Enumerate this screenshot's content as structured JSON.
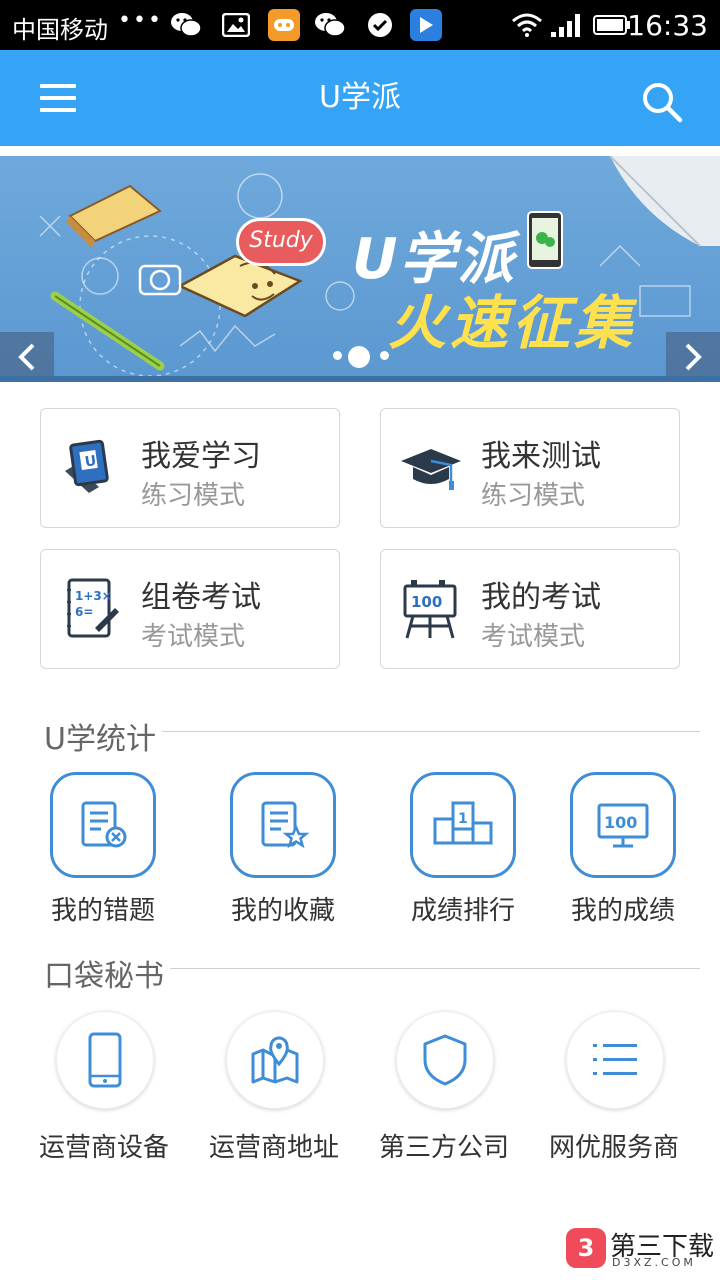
{
  "status_bar": {
    "carrier": "中国移动",
    "dots": "•••",
    "time": "16:33"
  },
  "app_bar": {
    "title": "U学派"
  },
  "banner": {
    "line1": "U学派",
    "line2": "火速征集",
    "study_tag": "Study"
  },
  "tiles": [
    {
      "title": "我爱学习",
      "subtitle": "练习模式",
      "icon": "book-icon"
    },
    {
      "title": "我来测试",
      "subtitle": "练习模式",
      "icon": "graduation-cap-icon"
    },
    {
      "title": "组卷考试",
      "subtitle": "考试模式",
      "icon": "math-notebook-icon"
    },
    {
      "title": "我的考试",
      "subtitle": "考试模式",
      "icon": "score-easel-icon"
    }
  ],
  "stats": {
    "title": "U学统计",
    "items": [
      {
        "label": "我的错题",
        "icon": "wrong-answers-icon"
      },
      {
        "label": "我的收藏",
        "icon": "favorites-icon"
      },
      {
        "label": "成绩排行",
        "icon": "ranking-icon"
      },
      {
        "label": "我的成绩",
        "icon": "score-monitor-icon"
      }
    ]
  },
  "pocket": {
    "title": "口袋秘书",
    "items": [
      {
        "label": "运营商设备",
        "icon": "phone-icon"
      },
      {
        "label": "运营商地址",
        "icon": "map-icon"
      },
      {
        "label": "第三方公司",
        "icon": "shield-icon"
      },
      {
        "label": "网优服务商",
        "icon": "list-icon"
      }
    ]
  },
  "watermark": {
    "name": "第三下载",
    "sub": "D3XZ.COM"
  },
  "colors": {
    "primary": "#35a3f6",
    "accent_icon": "#3e8dd6"
  }
}
